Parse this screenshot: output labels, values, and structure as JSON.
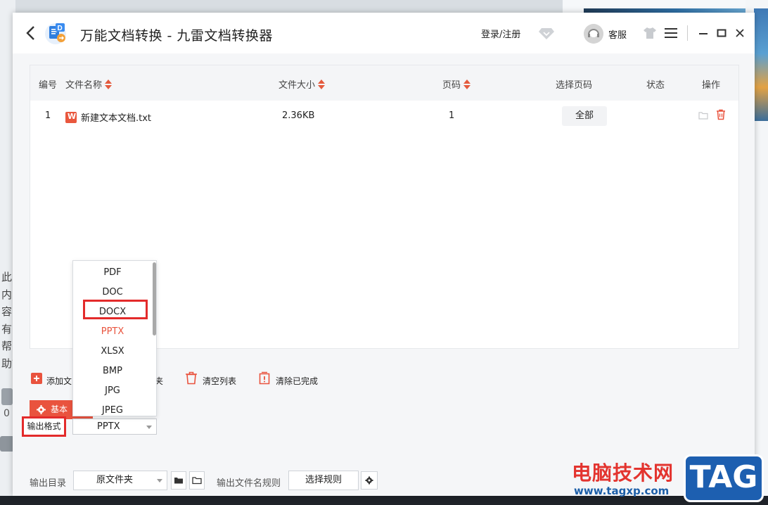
{
  "background": {
    "side_text": "此内容有帮助？",
    "like_count": "0"
  },
  "titlebar": {
    "title": "万能文档转换 - 九雷文档转换器",
    "login": "登录/注册",
    "support": "客服"
  },
  "table": {
    "headers": {
      "index": "编号",
      "name": "文件名称",
      "size": "文件大小",
      "pages": "页码",
      "select_pages": "选择页码",
      "status": "状态",
      "actions": "操作"
    },
    "rows": [
      {
        "index": "1",
        "name": "新建文本文档.txt",
        "size": "2.36KB",
        "pages": "1",
        "select_pages": "全部",
        "status": ""
      }
    ]
  },
  "toolbar": {
    "add_file": "添加文",
    "add_folder_tail": "夹",
    "clear_list": "清空列表",
    "clear_done": "清除已完成"
  },
  "settings": {
    "basic": "基本"
  },
  "output_format": {
    "label": "输出格式",
    "selected": "PPTX",
    "options": [
      "PDF",
      "DOC",
      "DOCX",
      "PPTX",
      "XLSX",
      "BMP",
      "JPG",
      "JPEG"
    ],
    "highlighted": "DOCX"
  },
  "bottom": {
    "out_dir_label": "输出目录",
    "out_dir_value": "原文件夹",
    "name_rule_label": "输出文件名规则",
    "rule_button": "选择规则"
  },
  "watermark": {
    "text": "电脑技术网",
    "url": "www.tagxp.com",
    "tag": "TAG"
  },
  "colors": {
    "accent": "#e9533e",
    "highlight_border": "#e32b2b",
    "watermark_blue": "#1d5fb0"
  }
}
